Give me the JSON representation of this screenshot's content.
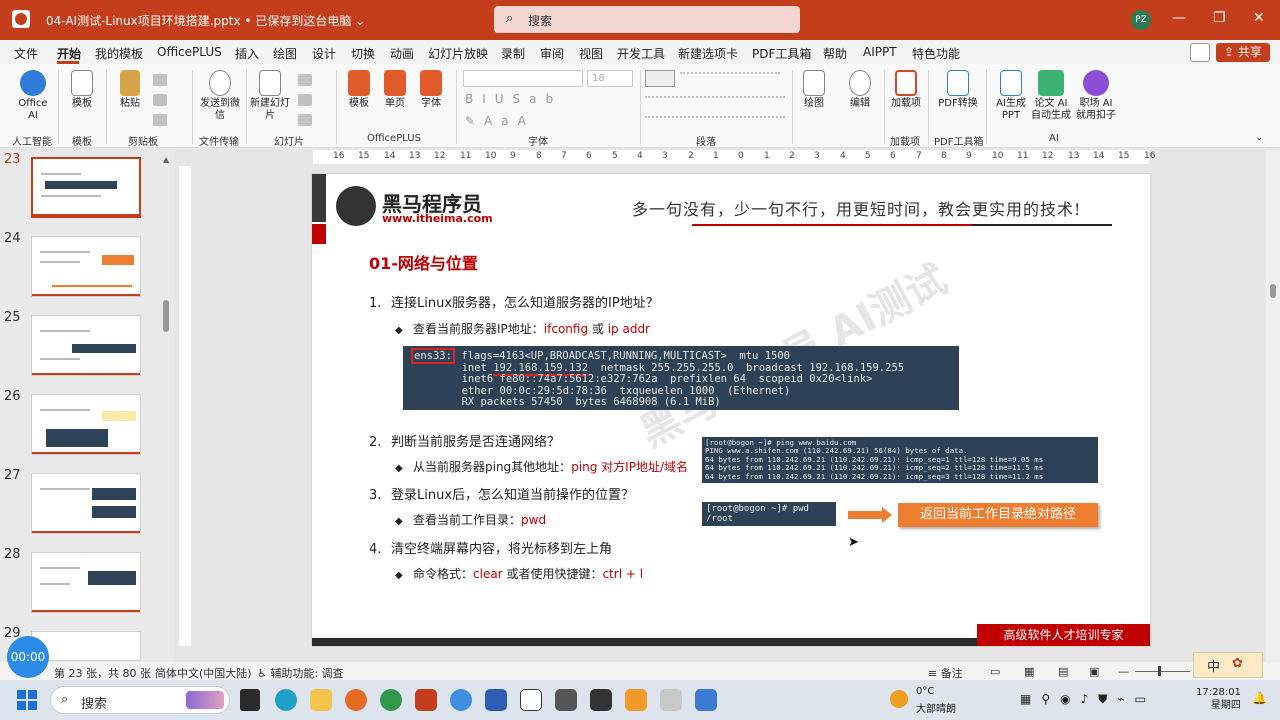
{
  "titlebar": {
    "filename": "04-AI测试-Linux项目环境搭建.pptx",
    "save_status": "已保存到这台电脑",
    "search_placeholder": "搜索",
    "avatar": "PZ"
  },
  "menu": {
    "tabs": [
      "文件",
      "开始",
      "我的模板",
      "OfficePLUS",
      "插入",
      "绘图",
      "设计",
      "切换",
      "动画",
      "幻灯片放映",
      "录制",
      "审阅",
      "视图",
      "开发工具",
      "新建选项卡",
      "PDF工具箱",
      "帮助",
      "AIPPT",
      "特色功能"
    ],
    "active": "开始",
    "share": "共享"
  },
  "ribbon": {
    "buttons": {
      "office_ai": "Office AI",
      "template": "模板",
      "paste": "粘贴",
      "send_wechat": "发送到微信",
      "new_slide": "新建幻灯片",
      "opl_template": "模板",
      "single_page": "单页",
      "font_btn": "字体",
      "drawing": "绘图",
      "editing": "编辑",
      "addins": "加载项",
      "pdf_convert": "PDF转换",
      "ai_ppt": "AI生成PPT",
      "paper_ai": "论文 AI 自动生成",
      "job_ai": "职场 AI 就用扣子"
    },
    "font_size": "18",
    "groups": [
      "人工智能",
      "模板",
      "剪贴板",
      "文件传输",
      "幻灯片",
      "OfficePLUS",
      "字体",
      "段落",
      "加载项",
      "PDF工具箱",
      "AI"
    ]
  },
  "thumbnails": {
    "numbers": [
      "23",
      "24",
      "25",
      "26",
      "27",
      "28",
      "29"
    ],
    "selected": "23"
  },
  "ruler": {
    "labels": [
      "16",
      "15",
      "14",
      "13",
      "12",
      "11",
      "10",
      "9",
      "8",
      "7",
      "6",
      "5",
      "4",
      "3",
      "2",
      "1",
      "0",
      "1",
      "2",
      "3",
      "4",
      "5",
      "6",
      "7",
      "8",
      "9",
      "10",
      "11",
      "12",
      "13",
      "14",
      "15",
      "16"
    ]
  },
  "slide": {
    "logo_name": "黑马程序员",
    "logo_url": "www.itheima.com",
    "slogan": "多一句没有，少一句不行，用更短时间，教会更实用的技术!",
    "title": "01-网络与位置",
    "watermark": "黑马程序员 AI测试",
    "items": [
      {
        "num": "1.",
        "text": "连接Linux服务器，怎么知道服务器的IP地址？"
      },
      {
        "num": "2.",
        "text": "判断当前服务是否连通网络？"
      },
      {
        "num": "3.",
        "text": "登录Linux后，怎么知道当前操作的位置？"
      },
      {
        "num": "4.",
        "text": "清空终端屏幕内容，将光标移到左上角"
      }
    ],
    "subs": [
      {
        "prefix": "查看当前服务器IP地址：",
        "cmd1": "ifconfig",
        "mid": " 或 ",
        "cmd2": "ip addr"
      },
      {
        "prefix": "从当前服务器ping其他地址：",
        "cmd1": "ping  对方IP地址/域名",
        "mid": "",
        "cmd2": ""
      },
      {
        "prefix": "查看当前工作目录：",
        "cmd1": "pwd",
        "mid": "",
        "cmd2": ""
      },
      {
        "prefix": "命令格式：",
        "cmd1": "clear",
        "mid": "  或者使用快捷键：",
        "cmd2": "ctrl + l"
      }
    ],
    "terminal1": {
      "iface": "ens33:",
      "line1_rest": " flags=4163<UP,BROADCAST,RUNNING,MULTICAST>  mtu 1500",
      "line2_pre": "        inet ",
      "line2_ip": "192.168.159.132",
      "line2_rest": "  netmask 255.255.255.0  broadcast 192.168.159.255",
      "line3": "        inet6 fe80::74a7:5612:e327:762a  prefixlen 64  scopeid 0x20<link>",
      "line4": "        ether 00:0c:29:5d:78:36  txqueuelen 1000  (Ethernet)",
      "line5": "        RX packets 57450  bytes 6468908 (6.1 MiB)"
    },
    "terminal2": [
      "[root@bogon ~]# ping www.baidu.com",
      "PING www.a.shifen.com (110.242.69.21) 56(84) bytes of data.",
      "64 bytes from 110.242.69.21 (110.242.69.21): icmp_seq=1 ttl=128 time=9.05 ms",
      "64 bytes from 110.242.69.21 (110.242.69.21): icmp_seq=2 ttl=128 time=11.5 ms",
      "64 bytes from 110.242.69.21 (110.242.69.21): icmp_seq=3 ttl=128 time=11.2 ms"
    ],
    "terminal3": [
      "[root@bogon ~]# pwd",
      "/root"
    ],
    "callout": "返回当前工作目录绝对路径",
    "footer": "高级软件人才培训专家"
  },
  "status": {
    "slide_info": "第 23 张，共 80 张",
    "language": "简体中文(中国大陆)",
    "accessibility": "辅助功能: 调查",
    "notes": "备注",
    "timer": "00:00",
    "ime": "中"
  },
  "taskbar": {
    "search_placeholder": "搜索",
    "weather_temp": "0°C",
    "weather_desc": "大部晴朗",
    "time": "17:28:01",
    "weekday": "星期四"
  },
  "colors": {
    "accent": "#c43e1c",
    "brand_red": "#c00000",
    "callout": "#ed7d31",
    "terminal_bg": "#2d4257"
  }
}
